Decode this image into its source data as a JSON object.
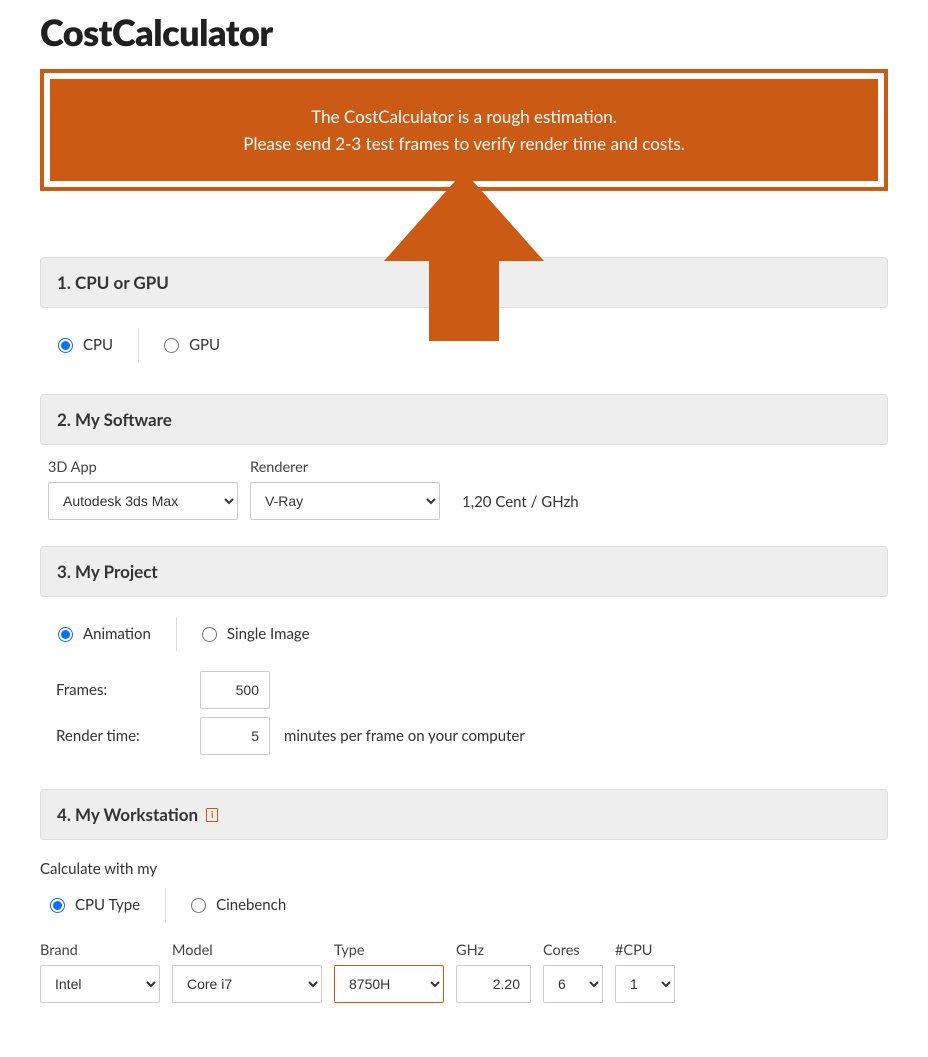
{
  "title": "CostCalculator",
  "banner": {
    "line1": "The CostCalculator is a rough estimation.",
    "line2": "Please send 2-3 test frames to verify render time and costs."
  },
  "sections": {
    "s1": {
      "heading": "1. CPU or GPU",
      "options": {
        "cpu": "CPU",
        "gpu": "GPU"
      },
      "selected": "CPU"
    },
    "s2": {
      "heading": "2. My Software",
      "app_label": "3D App",
      "app_value": "Autodesk 3ds Max",
      "renderer_label": "Renderer",
      "renderer_value": "V-Ray",
      "price_text": "1,20 Cent / GHzh"
    },
    "s3": {
      "heading": "3. My Project",
      "options": {
        "anim": "Animation",
        "single": "Single Image"
      },
      "selected": "Animation",
      "frames_label": "Frames:",
      "frames_value": "500",
      "rtime_label": "Render time:",
      "rtime_value": "5",
      "rtime_hint": "minutes per frame on your computer"
    },
    "s4": {
      "heading": "4. My Workstation",
      "calc_label": "Calculate with my",
      "options": {
        "cputype": "CPU Type",
        "cinebench": "Cinebench"
      },
      "selected": "CPU Type",
      "cols": {
        "brand": {
          "label": "Brand",
          "value": "Intel"
        },
        "model": {
          "label": "Model",
          "value": "Core i7"
        },
        "type": {
          "label": "Type",
          "value": "8750H"
        },
        "ghz": {
          "label": "GHz",
          "value": "2.20"
        },
        "cores": {
          "label": "Cores",
          "value": "6"
        },
        "ncpu": {
          "label": "#CPU",
          "value": "1"
        }
      }
    }
  }
}
